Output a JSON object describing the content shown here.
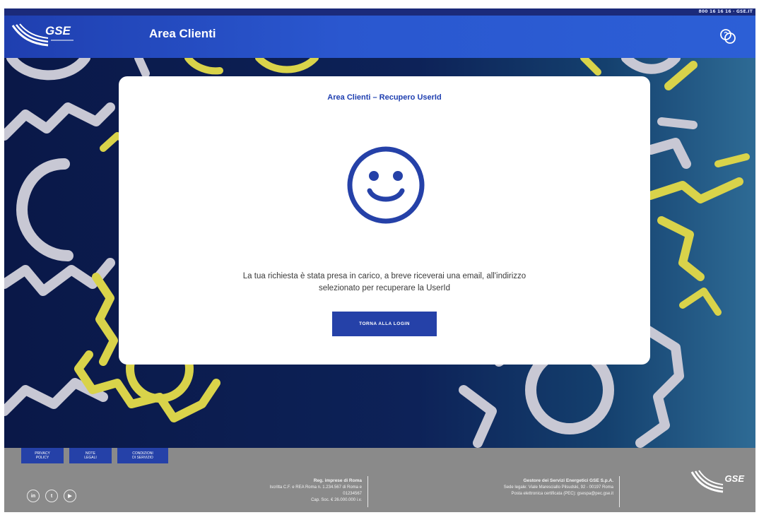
{
  "topbar": {
    "phone": "800 16 16 16 · GSE.IT"
  },
  "header": {
    "logo_text": "GSE",
    "title": "Area Clienti",
    "help_icon": "support-chat-icon"
  },
  "card": {
    "title": "Area Clienti – Recupero UserId",
    "icon": "smiley-icon",
    "message_line1": "La tua richiesta è stata presa in carico, a breve riceverai una email, all'indirizzo",
    "message_line2": "selezionato per recuperare la UserId",
    "button_label": "TORNA ALLA LOGIN"
  },
  "footer": {
    "buttons": [
      {
        "line1": "PRIVACY",
        "line2": "POLICY"
      },
      {
        "line1": "NOTE",
        "line2": "LEGALI"
      },
      {
        "line1": "CONDIZIONI",
        "line2": "DI SERVIZIO"
      }
    ],
    "social": [
      {
        "icon": "linkedin-icon",
        "glyph": "in"
      },
      {
        "icon": "twitter-icon",
        "glyph": "t"
      },
      {
        "icon": "youtube-icon",
        "glyph": "▶"
      }
    ],
    "registry": {
      "title": "Reg. imprese di Roma",
      "line1": "Iscritta C.F. e REA Roma n. 1.234.567 di Roma e",
      "line2": "01234567",
      "line3": "Cap. Soc. € 26.000.000 i.v."
    },
    "company": {
      "title": "Gestore dei Servizi Energetici GSE S.p.A.",
      "line1": "Sede legale: Viale Maresciallo Pilsudski, 92 - 00197 Roma",
      "line2": "Posta elettronica certificata (PEC): gsespa@pec.gse.it"
    },
    "logo_text": "GSE"
  },
  "colors": {
    "primary": "#2541a8",
    "header_start": "#1f3fb0",
    "hero_dark": "#0a1848",
    "gear_gray": "#c8c8d4",
    "gear_yellow": "#d9d34a",
    "footer": "#8a8a8a"
  }
}
